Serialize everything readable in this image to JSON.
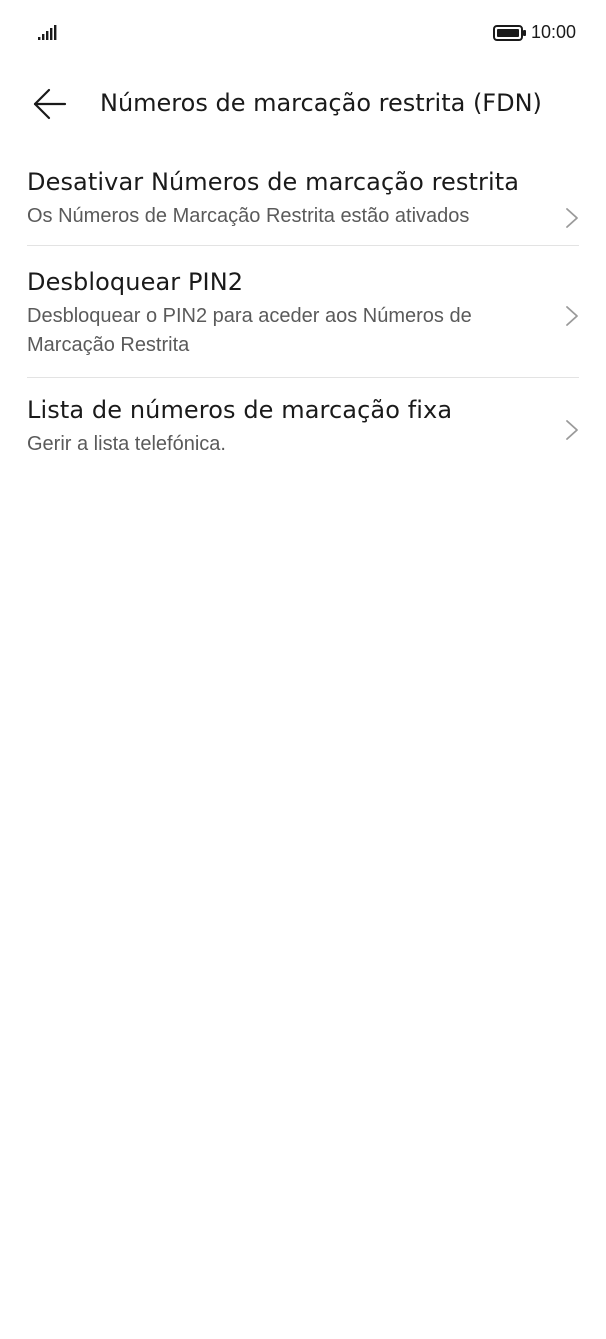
{
  "status_bar": {
    "time": "10:00",
    "signal_icon": "signal-bars-icon",
    "battery_icon": "battery-full-icon"
  },
  "header": {
    "back_icon": "arrow-left-icon",
    "title": "Números de marcação restrita (FDN)"
  },
  "items": [
    {
      "title": "Desativar Números de marcação restrita",
      "subtitle": "Os Números de Marcação Restrita estão ativados",
      "icon": "chevron-right-icon"
    },
    {
      "title": "Desbloquear PIN2",
      "subtitle": "Desbloquear o PIN2 para aceder aos Números de Marcação Restrita",
      "icon": "chevron-right-icon"
    },
    {
      "title": "Lista de números de marcação fixa",
      "subtitle": "Gerir a lista telefónica.",
      "icon": "chevron-right-icon"
    }
  ],
  "colors": {
    "background": "#ffffff",
    "text_primary": "#1a1a1a",
    "text_secondary": "#5a5a5a",
    "divider": "#e3e3e3",
    "chevron": "#9a9a9a"
  }
}
